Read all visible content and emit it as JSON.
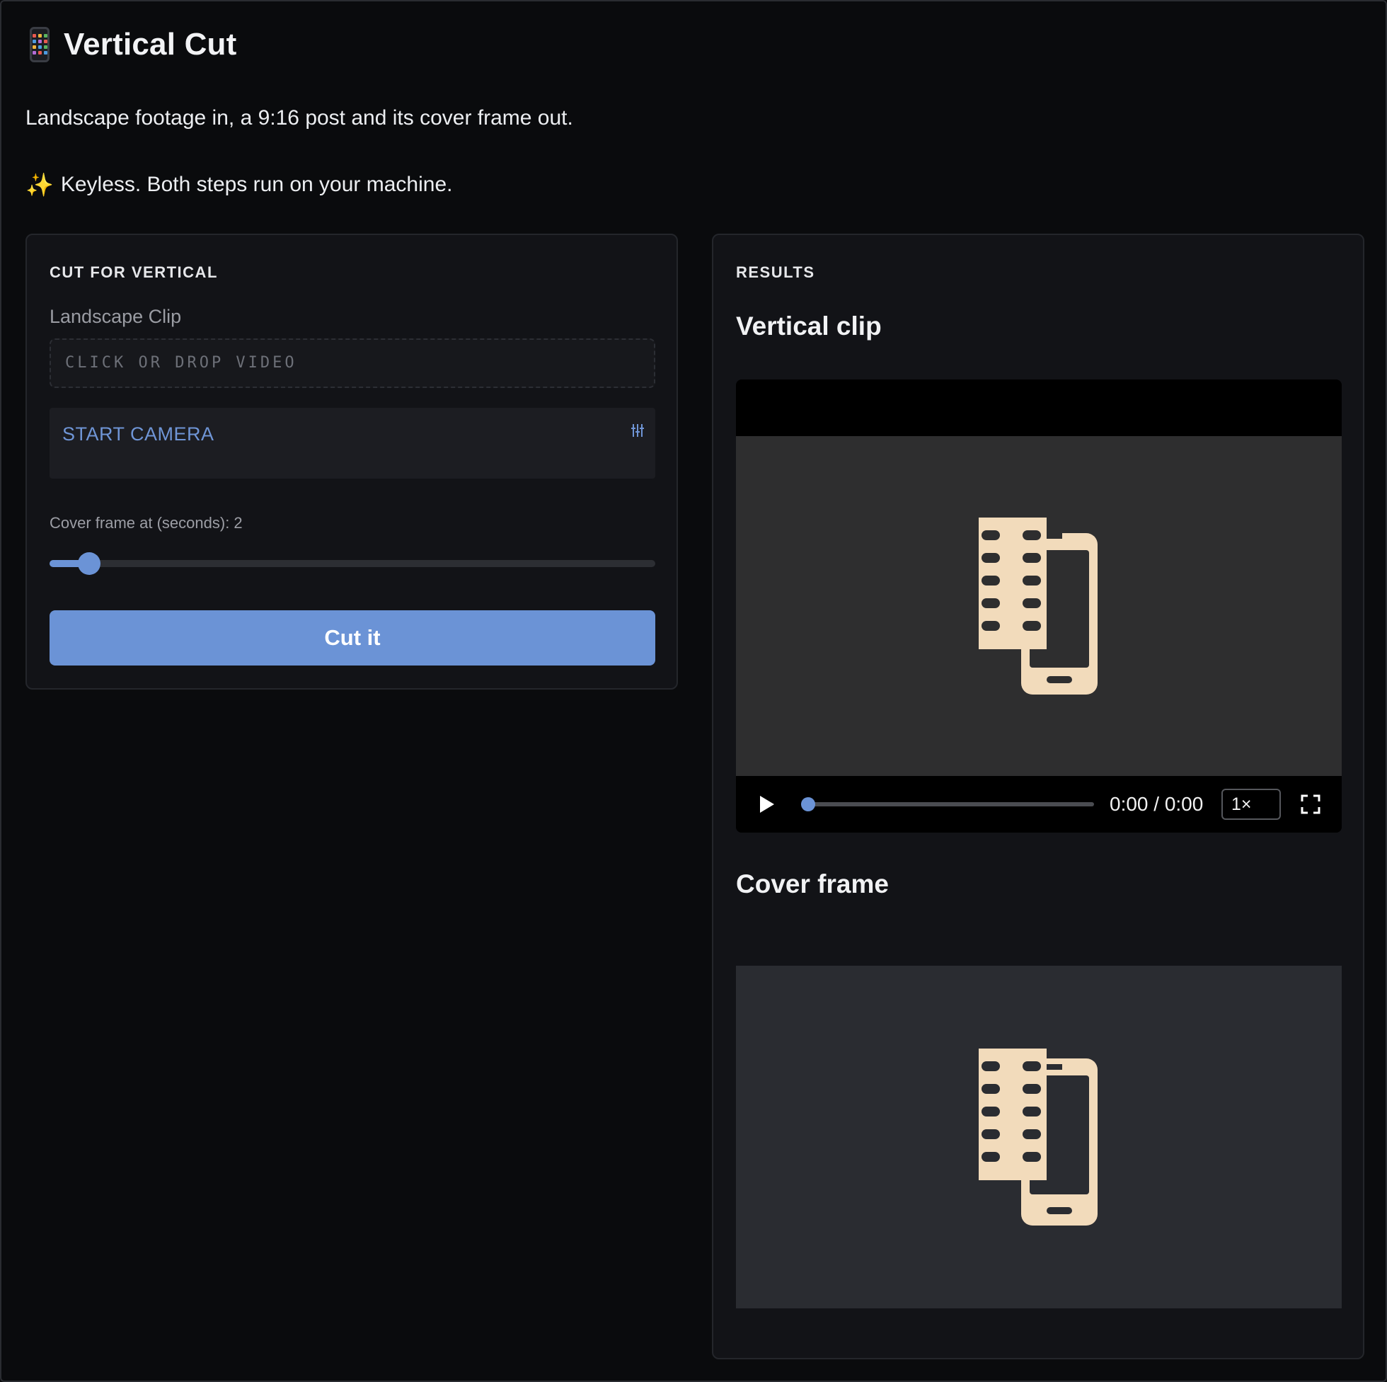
{
  "app": {
    "icon": "mobile-phone-icon",
    "title": "Vertical Cut",
    "description": "Landscape footage in, a 9:16 post and its cover frame out.",
    "note": "Keyless. Both steps run on your machine.",
    "note_icon": "sparkles-icon"
  },
  "cut_panel": {
    "heading": "CUT FOR VERTICAL",
    "clip_label": "Landscape Clip",
    "drop_zone_text": "CLICK OR DROP VIDEO",
    "camera_button": "START CAMERA",
    "camera_icon": "camera-settings-icon",
    "slider_label": "Cover frame at (seconds): 2",
    "slider_value_fraction": 0.065,
    "submit_label": "Cut it"
  },
  "results_panel": {
    "heading": "RESULTS",
    "video_heading": "Vertical clip",
    "video": {
      "time": "0:00 / 0:00",
      "speed": "1×",
      "progress_fraction": 0,
      "play_icon": "play-icon",
      "fullscreen_icon": "fullscreen-icon",
      "thumbnail_icon": "film-to-phone-icon"
    },
    "cover_heading": "Cover frame",
    "cover_icon": "film-to-phone-icon"
  },
  "colors": {
    "accent": "#6b93d6",
    "background": "#0a0b0d",
    "panel": "#121317",
    "art": "#f2dbbb"
  }
}
